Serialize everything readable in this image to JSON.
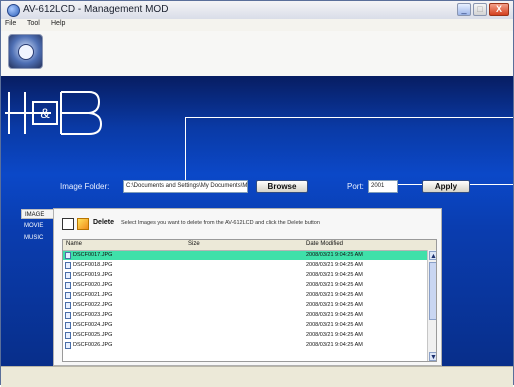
{
  "window": {
    "title": "AV-612LCD - Management MOD",
    "controls": {
      "minimize": "_",
      "maximize": "□",
      "close": "X"
    }
  },
  "menu": [
    "File",
    "Tool",
    "Help"
  ],
  "brand": {
    "logo_left": "H",
    "logo_amp": "&",
    "logo_right": "B"
  },
  "form": {
    "image_folder_label": "Image Folder:",
    "image_folder_value": "C:\\Documents and Settings\\My Documents\\My Pictures",
    "browse_label": "Browse",
    "port_label": "Port:",
    "port_value": "2001",
    "apply_label": "Apply"
  },
  "side_tabs": [
    "IMAGE",
    "MOVIE",
    "MUSIC"
  ],
  "file_panel": {
    "delete_label": "Delete",
    "note": "Select Images you want to delete from the AV-612LCD and click the Delete button",
    "columns": [
      "Name",
      "Size",
      "Date Modified"
    ],
    "rows": [
      {
        "name": "DSCF0017.JPG",
        "date": "2008/03/21 9:04:25 AM"
      },
      {
        "name": "DSCF0018.JPG",
        "date": "2008/03/21 9:04:25 AM"
      },
      {
        "name": "DSCF0019.JPG",
        "date": "2008/03/21 9:04:25 AM"
      },
      {
        "name": "DSCF0020.JPG",
        "date": "2008/03/21 9:04:25 AM"
      },
      {
        "name": "DSCF0021.JPG",
        "date": "2008/03/21 9:04:25 AM"
      },
      {
        "name": "DSCF0022.JPG",
        "date": "2008/03/21 9:04:25 AM"
      },
      {
        "name": "DSCF0023.JPG",
        "date": "2008/03/21 9:04:25 AM"
      },
      {
        "name": "DSCF0024.JPG",
        "date": "2008/03/21 9:04:25 AM"
      },
      {
        "name": "DSCF0025.JPG",
        "date": "2008/03/21 9:04:25 AM"
      },
      {
        "name": "DSCF0026.JPG",
        "date": "2008/03/21 9:04:25 AM"
      }
    ],
    "selected_index": 0
  },
  "colors": {
    "banner": "#0b48c8",
    "selected_row": "#3fe0a9"
  },
  "icons": [
    "app-icon",
    "cd-disc-icon",
    "file-icon",
    "scroll-up-icon",
    "scroll-down-icon"
  ]
}
